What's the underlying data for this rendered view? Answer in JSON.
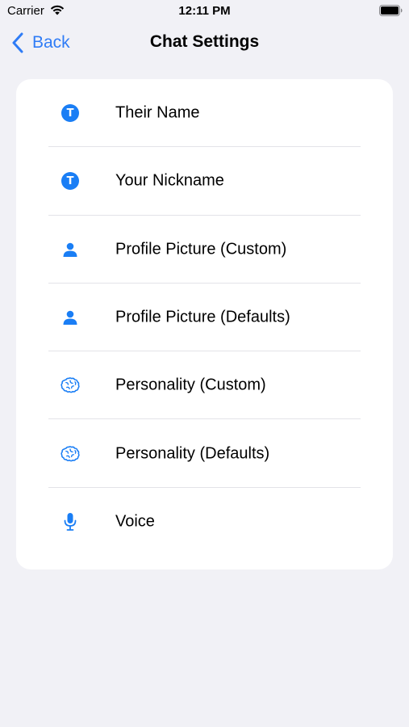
{
  "status_bar": {
    "carrier": "Carrier",
    "time": "12:11 PM"
  },
  "nav": {
    "back_label": "Back",
    "title": "Chat Settings"
  },
  "colors": {
    "accent": "#1a7ef5",
    "background": "#f1f1f6",
    "card": "#ffffff"
  },
  "settings": {
    "items": [
      {
        "label": "Their Name",
        "icon": "text-badge-icon",
        "badge": "T"
      },
      {
        "label": "Your Nickname",
        "icon": "text-badge-icon",
        "badge": "T"
      },
      {
        "label": "Profile Picture (Custom)",
        "icon": "person-icon"
      },
      {
        "label": "Profile Picture (Defaults)",
        "icon": "person-icon"
      },
      {
        "label": "Personality (Custom)",
        "icon": "brain-icon"
      },
      {
        "label": "Personality (Defaults)",
        "icon": "brain-icon"
      },
      {
        "label": "Voice",
        "icon": "microphone-icon"
      }
    ]
  }
}
